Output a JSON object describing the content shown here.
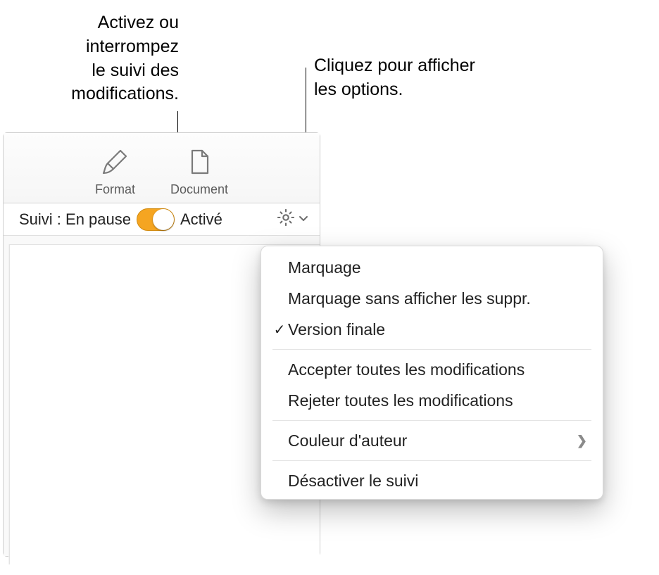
{
  "callouts": {
    "toggle_text_l1": "Activez ou",
    "toggle_text_l2": "interrompez",
    "toggle_text_l3": "le suivi des",
    "toggle_text_l4": "modifications.",
    "options_text_l1": "Cliquez pour afficher",
    "options_text_l2": "les options."
  },
  "toolbar": {
    "format_label": "Format",
    "document_label": "Document"
  },
  "tracking": {
    "status_prefix": "Suivi : ",
    "status_value": "En pause",
    "active_label": "Activé"
  },
  "menu": {
    "markup": "Marquage",
    "markup_no_delete": "Marquage sans afficher les suppr.",
    "final_version": "Version finale",
    "accept_all": "Accepter toutes les modifications",
    "reject_all": "Rejeter toutes les modifications",
    "author_color": "Couleur d'auteur",
    "turn_off": "Désactiver le suivi"
  }
}
